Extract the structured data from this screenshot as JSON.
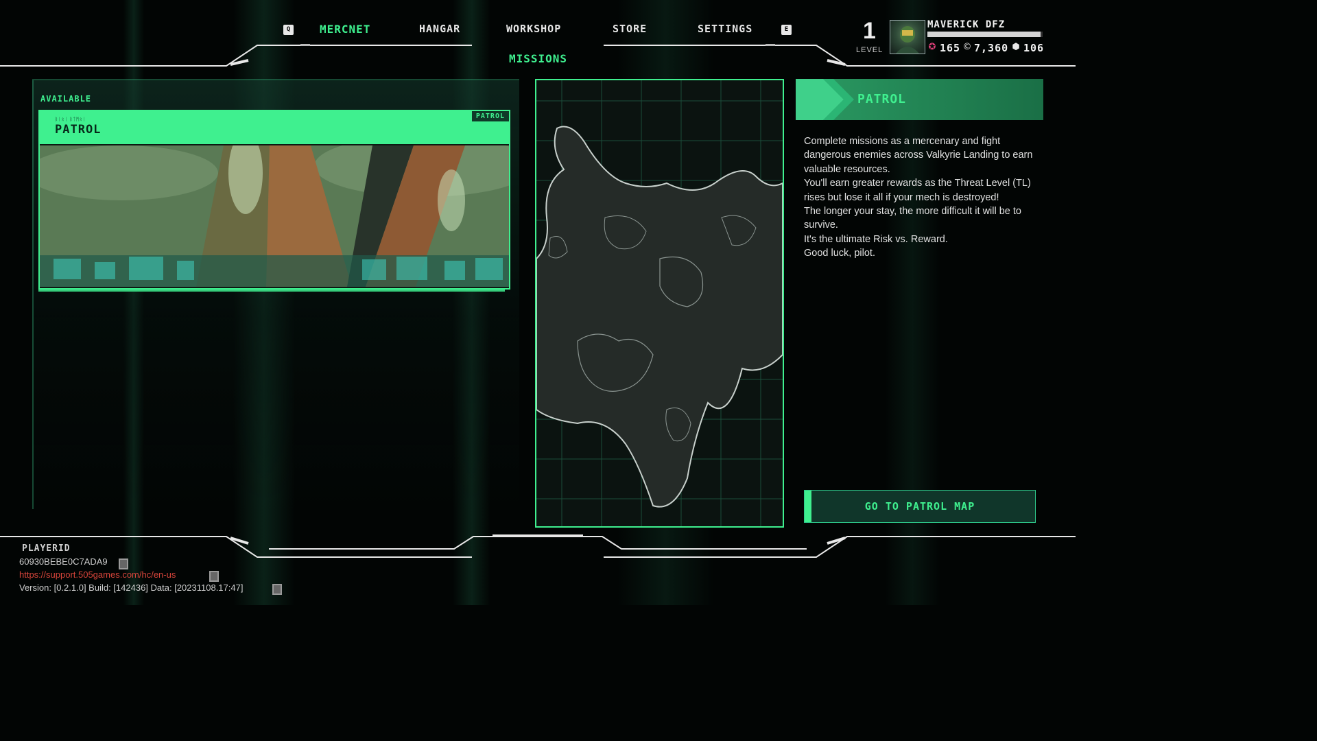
{
  "nav": {
    "left_key": "Q",
    "right_key": "E",
    "items": [
      {
        "label": "MERCNET",
        "active": true
      },
      {
        "label": "HANGAR",
        "active": false
      },
      {
        "label": "WORKSHOP",
        "active": false
      },
      {
        "label": "STORE",
        "active": false
      },
      {
        "label": "SETTINGS",
        "active": false
      }
    ],
    "sub_title": "MISSIONS"
  },
  "player": {
    "level": "1",
    "level_label": "LEVEL",
    "name": "MAVERICK DFZ",
    "xp_fraction": 0.98,
    "currencies": [
      {
        "icon": "scrap-icon",
        "value": "165",
        "color": "#e0407a"
      },
      {
        "icon": "credits-icon",
        "value": "7,360",
        "color": "#f0f0f0"
      },
      {
        "icon": "cube-icon",
        "value": "106",
        "color": "#f0f0f0"
      }
    ]
  },
  "missions": {
    "section_label": "AVAILABLE",
    "card": {
      "tag": "PATROL",
      "small_text": "ᛒᛁᛟᛁ ᛒᛏᛗᛟᛁ",
      "title": "PATROL"
    }
  },
  "info": {
    "title": "PATROL",
    "paragraphs": [
      "Complete missions as a mercenary and fight dangerous enemies across Valkyrie Landing to earn valuable resources.",
      "You'll earn greater rewards as the Threat Level (TL) rises but lose it all if your mech is destroyed!",
      "The longer your stay, the more difficult it will be to survive.",
      "It's the ultimate Risk vs. Reward.",
      "Good luck, pilot."
    ],
    "button_label": "GO TO PATROL MAP"
  },
  "footer": {
    "player_id_label": "PLAYERID",
    "player_id": "60930BEBE0C7ADA9",
    "support_url": "https://support.505games.com/hc/en-us",
    "version": "Version: [0.2.1.0] Build: [142436] Data: [20231108.17:47]"
  },
  "colors": {
    "accent": "#3ff08f",
    "link": "#d8453b"
  }
}
